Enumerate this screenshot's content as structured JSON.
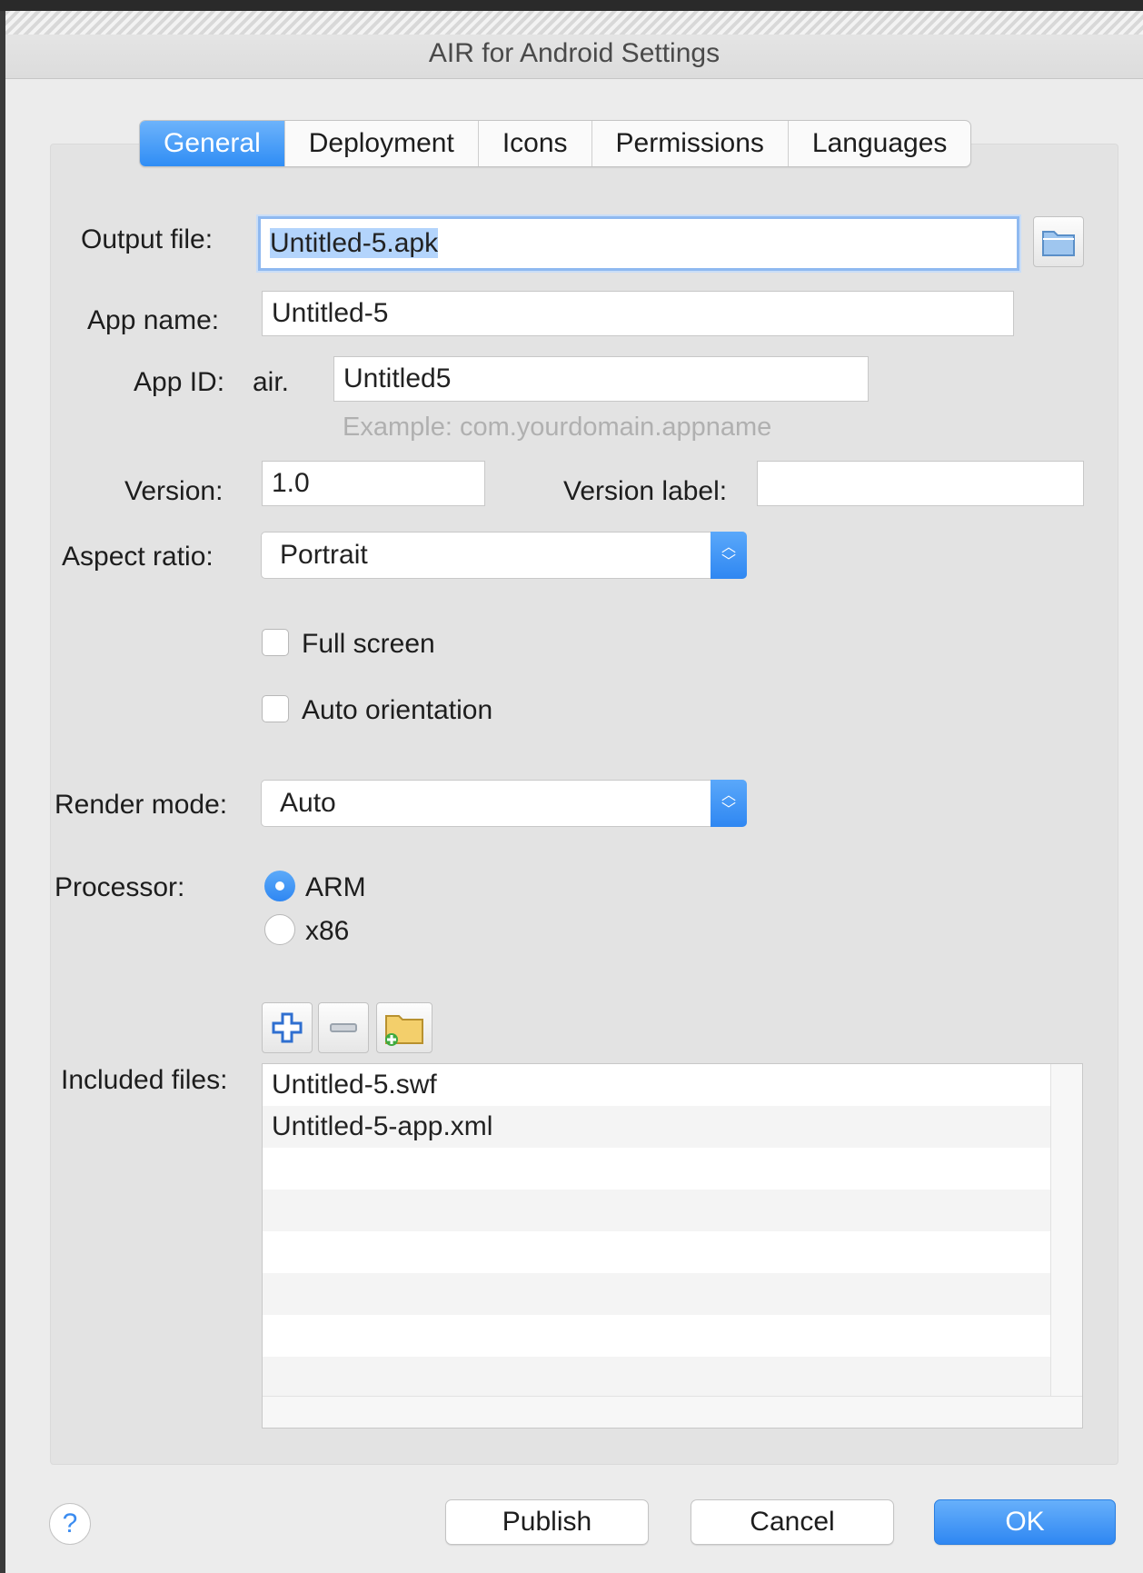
{
  "window": {
    "title": "AIR for Android Settings"
  },
  "tabs": [
    {
      "label": "General",
      "active": true
    },
    {
      "label": "Deployment",
      "active": false
    },
    {
      "label": "Icons",
      "active": false
    },
    {
      "label": "Permissions",
      "active": false
    },
    {
      "label": "Languages",
      "active": false
    }
  ],
  "form": {
    "output_file": {
      "label": "Output file:",
      "value": "Untitled-5.apk"
    },
    "app_name": {
      "label": "App name:",
      "value": "Untitled-5"
    },
    "app_id": {
      "label": "App ID:",
      "prefix": "air.",
      "value": "Untitled5",
      "hint": "Example: com.yourdomain.appname"
    },
    "version": {
      "label": "Version:",
      "value": "1.0"
    },
    "version_label": {
      "label": "Version label:",
      "value": ""
    },
    "aspect_ratio": {
      "label": "Aspect ratio:",
      "value": "Portrait"
    },
    "full_screen": {
      "label": "Full screen",
      "checked": false
    },
    "auto_orientation": {
      "label": "Auto orientation",
      "checked": false
    },
    "render_mode": {
      "label": "Render mode:",
      "value": "Auto"
    },
    "processor": {
      "label": "Processor:",
      "options": [
        "ARM",
        "x86"
      ],
      "selected": "ARM"
    },
    "included_files": {
      "label": "Included files:",
      "files": [
        "Untitled-5.swf",
        "Untitled-5-app.xml"
      ]
    }
  },
  "icons": {
    "browse": "folder-icon",
    "add": "plus-icon",
    "remove": "minus-icon",
    "add_folder": "add-folder-icon",
    "help": "help-icon"
  },
  "buttons": {
    "help": "?",
    "publish": "Publish",
    "cancel": "Cancel",
    "ok": "OK"
  },
  "colors": {
    "accent": "#2f87f2",
    "background": "#ececec"
  }
}
